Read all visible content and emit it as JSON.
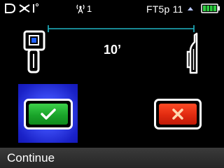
{
  "status_bar": {
    "logo_text": "DCI",
    "logo_icon": "dci-logo-icon",
    "signal_icon": "antenna-signal-icon",
    "signal_count": "1",
    "frequency": "FT5p 11",
    "frequency_arrow_icon": "triangle-up-icon",
    "battery_icon": "battery-full-icon",
    "battery_color": "#2ecc40"
  },
  "measurement": {
    "distance": "10’",
    "ruler_color": "#21b6c6"
  },
  "icons": {
    "locator": "locator-receiver-icon",
    "sonde": "drill-head-icon"
  },
  "actions": {
    "yes_icon": "checkmark-icon",
    "no_icon": "x-cross-icon",
    "highlight_color": "#2c3cf0"
  },
  "footer": {
    "label": "Continue"
  }
}
